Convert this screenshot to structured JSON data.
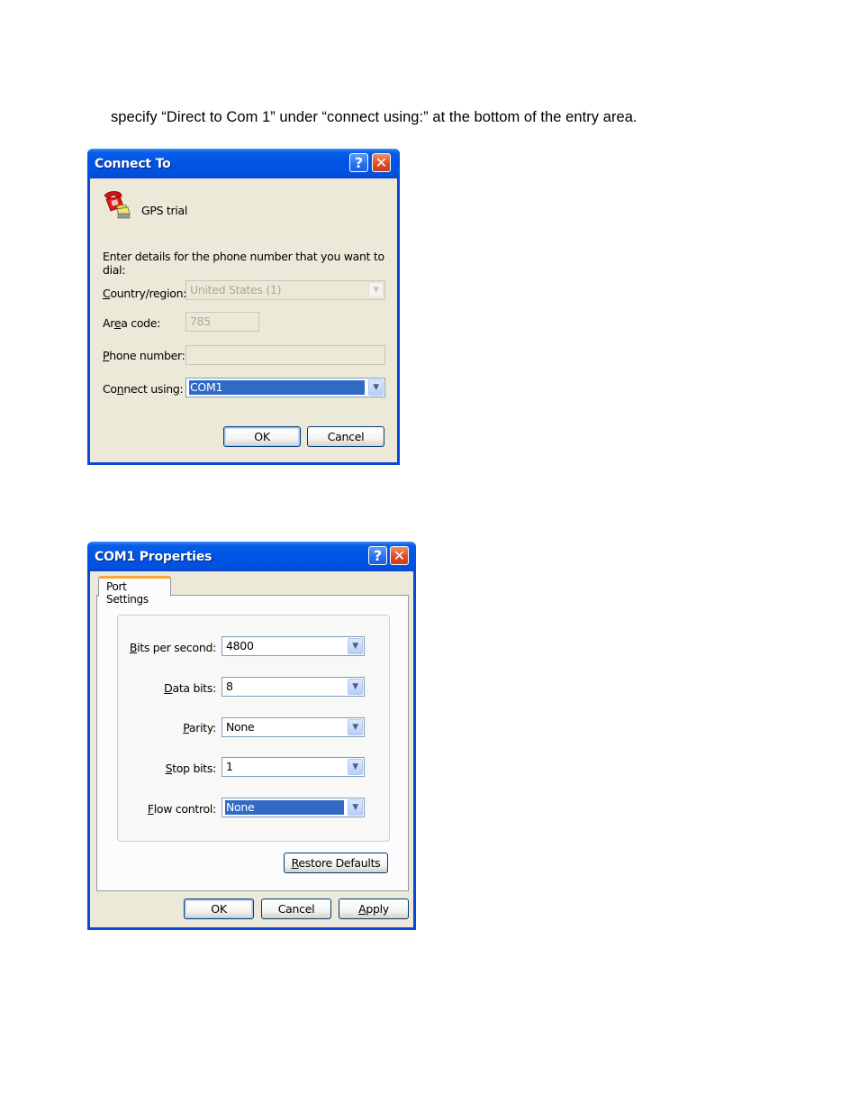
{
  "document": {
    "instruction_text": "specify “Direct to Com 1” under “connect using:” at the bottom of the entry area."
  },
  "connect_to_dialog": {
    "title": "Connect To",
    "help_button": "?",
    "close_button": "✕",
    "connection_icon": "telephone-icon",
    "connection_name": "GPS trial",
    "prompt": "Enter details for the phone number that you want to dial:",
    "fields": {
      "country_region": {
        "label_access_key": "C",
        "label_rest": "ountry/region:",
        "value": "United States (1)",
        "disabled": true
      },
      "area_code": {
        "label_pre": "Ar",
        "label_access_key": "e",
        "label_rest": "a code:",
        "value": "785",
        "disabled": true
      },
      "phone_number": {
        "label_access_key": "P",
        "label_rest": "hone number:",
        "value": "",
        "disabled": true
      },
      "connect_using": {
        "label_pre": "Co",
        "label_access_key": "n",
        "label_rest": "nect using:",
        "value": "COM1",
        "selected": true
      }
    },
    "buttons": {
      "ok": "OK",
      "cancel": "Cancel"
    }
  },
  "com_properties_dialog": {
    "title": "COM1 Properties",
    "help_button": "?",
    "close_button": "✕",
    "tabs": [
      {
        "label": "Port Settings",
        "active": true
      }
    ],
    "fields": {
      "bits_per_second": {
        "label_access_key": "B",
        "label_rest": "its per second:",
        "value": "4800"
      },
      "data_bits": {
        "label_access_key": "D",
        "label_rest": "ata bits:",
        "value": "8"
      },
      "parity": {
        "label_access_key": "P",
        "label_rest": "arity:",
        "value": "None"
      },
      "stop_bits": {
        "label_access_key": "S",
        "label_rest": "top bits:",
        "value": "1"
      },
      "flow_control": {
        "label_access_key": "F",
        "label_rest": "low control:",
        "value": "None",
        "selected": true
      }
    },
    "restore_defaults": {
      "access_key": "R",
      "rest": "estore Defaults"
    },
    "buttons": {
      "ok": "OK",
      "cancel": "Cancel",
      "apply_access_key": "A",
      "apply_rest": "pply"
    }
  },
  "colors": {
    "titlebar_blue": "#0055e5",
    "window_face": "#ece9d8",
    "selection_blue": "#316ac5",
    "tab_accent": "#f7a634",
    "close_red": "#e0502a"
  }
}
